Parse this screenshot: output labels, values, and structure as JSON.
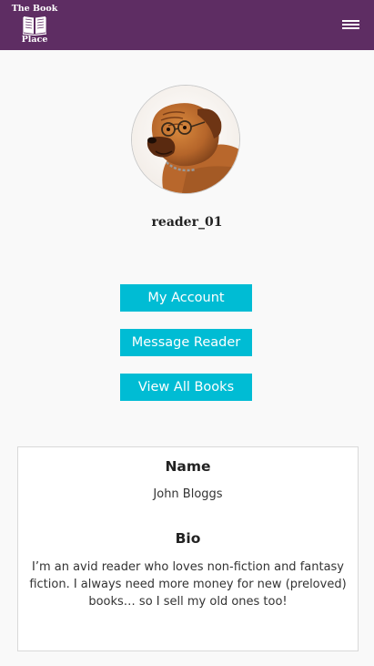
{
  "navbar": {
    "brand_line1": "The Book",
    "brand_line2": "Place",
    "brand_icon": "open-book-icon",
    "menu_icon": "hamburger-menu-icon",
    "background_color": "#5e2d63"
  },
  "profile": {
    "avatar_icon": "dog-avatar-photo",
    "username": "reader_01"
  },
  "actions": {
    "my_account": "My Account",
    "message_reader": "Message Reader",
    "view_all_books": "View All Books",
    "button_color": "#00bcd4"
  },
  "details": {
    "name_heading": "Name",
    "name_value": "John Bloggs",
    "bio_heading": "Bio",
    "bio_value": "I’m an avid reader who loves non-fiction and fantasy fiction. I always need more money for new (preloved) books… so I sell my old ones too!"
  }
}
